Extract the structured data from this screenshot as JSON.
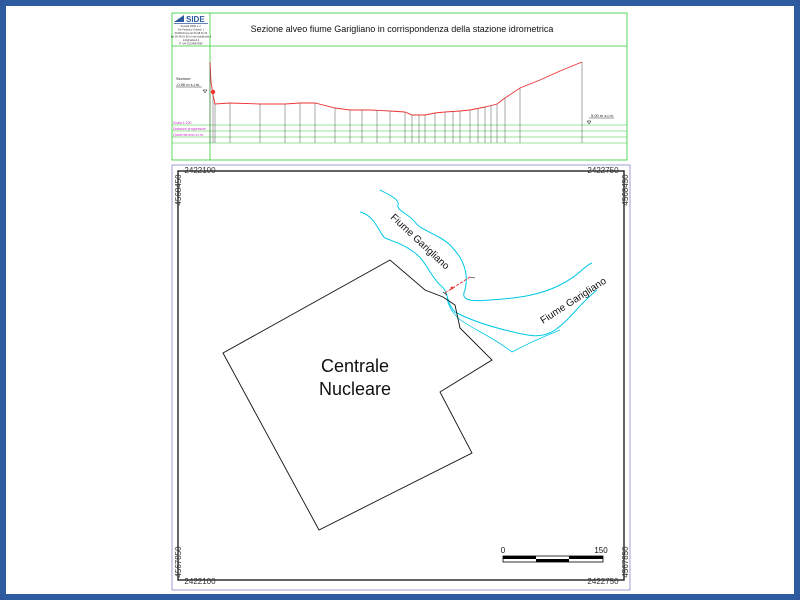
{
  "colors": {
    "frame_blue": "#2e5aa0",
    "grid_green": "#33cc33",
    "profile_red": "#ee3333",
    "river_cyan": "#00c8e6",
    "label_magenta": "#cc33cc",
    "line_black": "#000000"
  },
  "section_panel": {
    "logo_text": "SIDE",
    "company_lines": [
      "Società SIDE s.r.l.",
      "Via Federico Orlandi, 1",
      "00184 Roma tel 06 48 01 64",
      "fax 06 48 01 65 e-mail side@side.it",
      "info@sidesrl.it",
      "P. IVA 01234567890"
    ],
    "title": "Sezione alveo fiume Garigliano in corrispondenza della stazione idrometrica",
    "zero_label_line1": "Sezione",
    "zero_label_line2": "-0,96 m s.l.m.",
    "right_level_label": "5,00 m s.l.m.",
    "row_labels": {
      "scale": "Scala 1:100",
      "progressive": "Distanze progressive",
      "elevations": "Quote terreno s.l.m."
    }
  },
  "map": {
    "coords": {
      "top_left_x": "2422100",
      "top_right_x": "2422750",
      "bottom_left_x": "2422100",
      "bottom_right_x": "2422750",
      "left_top_y": "4568450",
      "left_bottom_y": "4567850",
      "right_top_y": "4568450",
      "right_bottom_y": "4567850"
    },
    "plant_label_line1": "Centrale",
    "plant_label_line2": "Nucleare",
    "river_label_upper": "Fiume Garigliano",
    "river_label_lower": "Fiume Garigliano",
    "scalebar_start": "0",
    "scalebar_end": "150"
  }
}
